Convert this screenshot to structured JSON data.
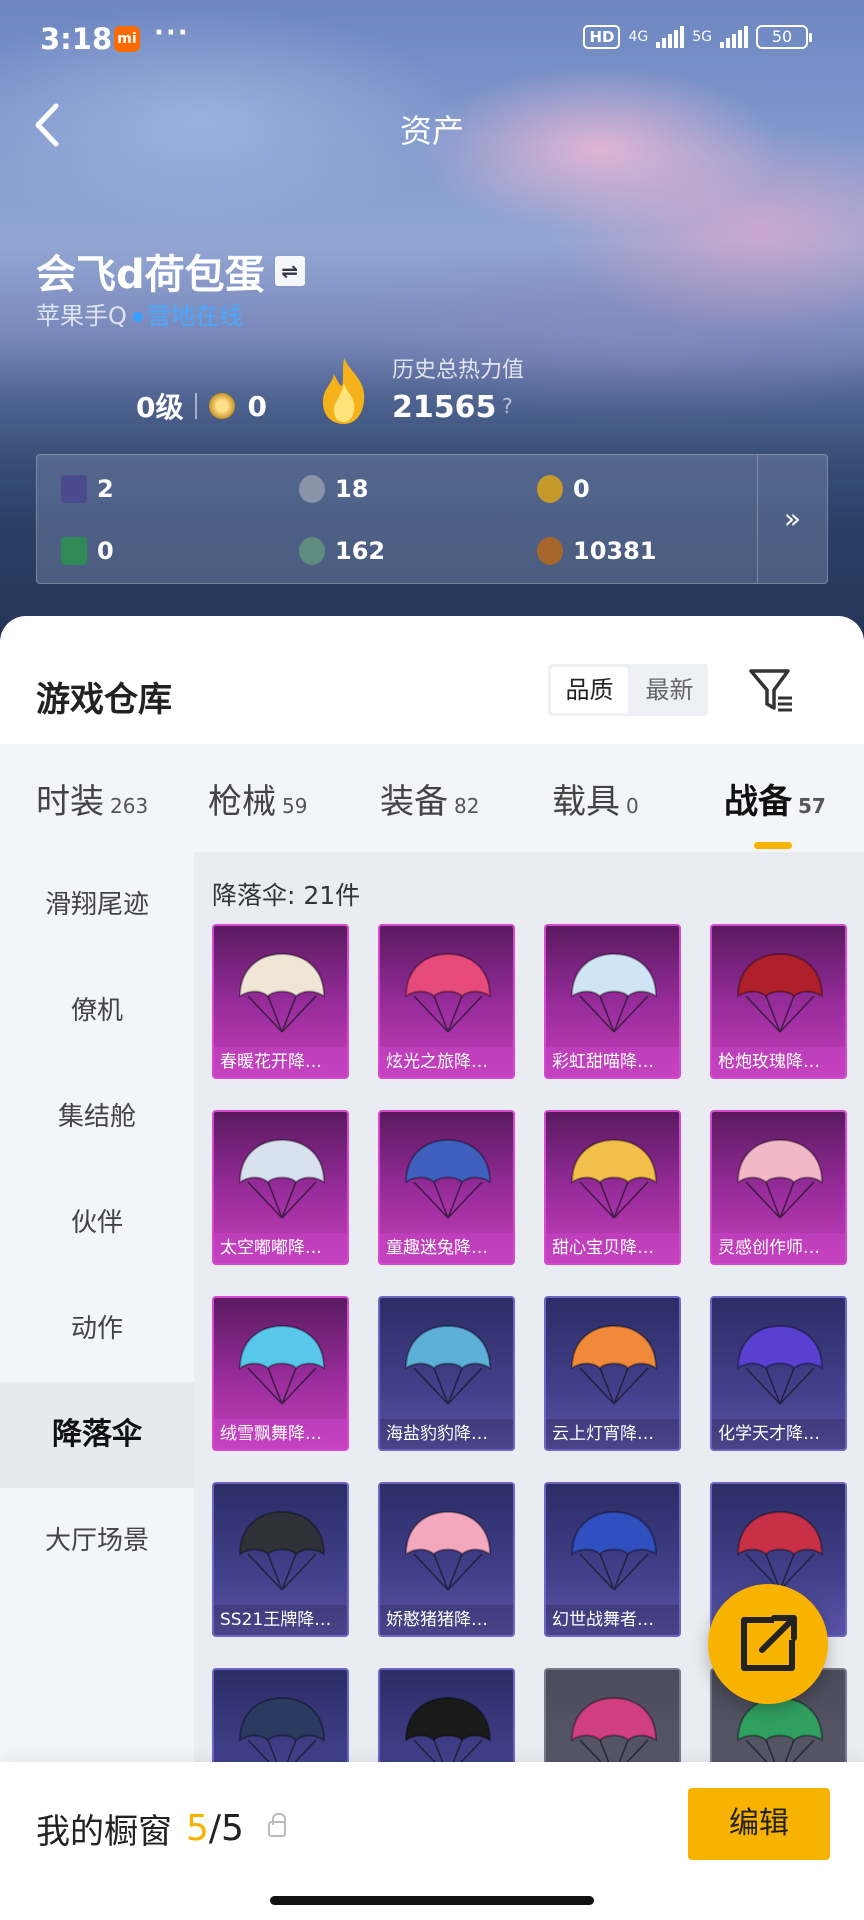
{
  "status_bar": {
    "time": "3:18",
    "mi_label": "mi",
    "dots": "···",
    "hd": "HD",
    "net1": "4G",
    "net2": "5G",
    "battery": "50"
  },
  "header": {
    "title": "资产"
  },
  "user": {
    "name": "会飞d荷包蛋",
    "platform": "苹果手Q",
    "status": "营地在线",
    "level": "0级",
    "medal_count": "0",
    "heat_label": "历史总热力值",
    "heat_value": "21565",
    "heat_help": "?"
  },
  "currencies": [
    {
      "value": "2",
      "icon": "card-icon",
      "color": "#4a4a8c"
    },
    {
      "value": "18",
      "icon": "silver-coin-icon",
      "color": "#8a93a8"
    },
    {
      "value": "0",
      "icon": "gold-coin-icon",
      "color": "#c69a2a"
    },
    {
      "value": "0",
      "icon": "green-card-icon",
      "color": "#2f8a55"
    },
    {
      "value": "162",
      "icon": "green-orb-icon",
      "color": "#5f8c80"
    },
    {
      "value": "10381",
      "icon": "bronze-coin-icon",
      "color": "#a8652a"
    }
  ],
  "currency_more": "»",
  "warehouse": {
    "title": "游戏仓库",
    "sort_options": [
      "品质",
      "最新"
    ],
    "sort_selected": "品质"
  },
  "tabs": [
    {
      "label": "时装",
      "count": "263"
    },
    {
      "label": "枪械",
      "count": "59"
    },
    {
      "label": "装备",
      "count": "82"
    },
    {
      "label": "载具",
      "count": "0"
    },
    {
      "label": "战备",
      "count": "57"
    }
  ],
  "active_tab": "战备",
  "sidebar": [
    "滑翔尾迹",
    "僚机",
    "集结舱",
    "伙伴",
    "动作",
    "降落伞",
    "大厅场景"
  ],
  "active_sidebar": "降落伞",
  "grid": {
    "heading": "降落伞: 21件",
    "items": [
      {
        "label": "春暖花开降…",
        "rarity": "purple",
        "color": "#efe6d6"
      },
      {
        "label": "炫光之旅降…",
        "rarity": "purple",
        "color": "#e64a7a"
      },
      {
        "label": "彩虹甜喵降…",
        "rarity": "purple",
        "color": "#cfe4f4"
      },
      {
        "label": "枪炮玫瑰降…",
        "rarity": "purple",
        "color": "#b0202a"
      },
      {
        "label": "太空嘟嘟降…",
        "rarity": "purple",
        "color": "#d8e2ef"
      },
      {
        "label": "童趣迷兔降…",
        "rarity": "purple",
        "color": "#4060c0"
      },
      {
        "label": "甜心宝贝降…",
        "rarity": "purple",
        "color": "#f2c04a"
      },
      {
        "label": "灵感创作师…",
        "rarity": "purple",
        "color": "#f2b8c8"
      },
      {
        "label": "绒雪飘舞降…",
        "rarity": "purple",
        "color": "#58c8ea"
      },
      {
        "label": "海盐豹豹降…",
        "rarity": "blue",
        "color": "#5cb0d8"
      },
      {
        "label": "云上灯宵降…",
        "rarity": "blue",
        "color": "#f08a3a"
      },
      {
        "label": "化学天才降…",
        "rarity": "blue",
        "color": "#5a40d0"
      },
      {
        "label": "SS21王牌降…",
        "rarity": "blue",
        "color": "#303038"
      },
      {
        "label": "娇憨猪猪降…",
        "rarity": "blue",
        "color": "#f4a8c0"
      },
      {
        "label": "幻世战舞者…",
        "rarity": "blue",
        "color": "#3050c0"
      },
      {
        "label": "",
        "rarity": "blue",
        "color": "#c83048"
      },
      {
        "label": "",
        "rarity": "blue",
        "color": "#2a3a60"
      },
      {
        "label": "",
        "rarity": "blue",
        "color": "#1a1a1a"
      },
      {
        "label": "",
        "rarity": "gray",
        "color": "#d04080"
      },
      {
        "label": "",
        "rarity": "gray",
        "color": "#30a060"
      }
    ]
  },
  "showcase": {
    "title": "我的橱窗",
    "used": "5",
    "sep": "/",
    "total": "5",
    "edit_label": "编辑"
  },
  "colors": {
    "accent": "#f8b300",
    "online": "#4aa8ff"
  }
}
